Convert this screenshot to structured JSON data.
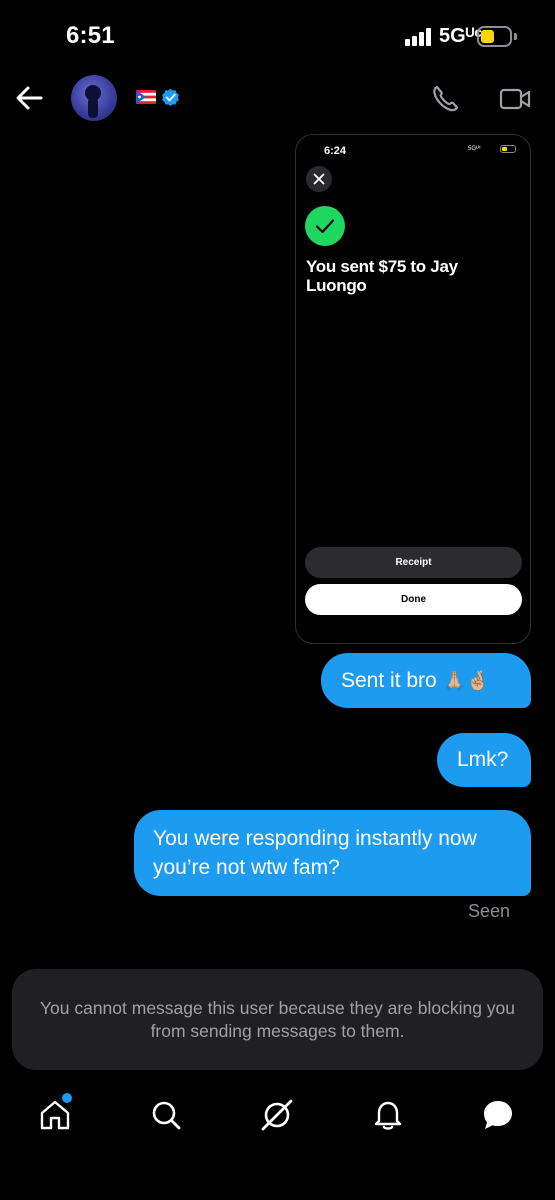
{
  "status_bar": {
    "time": "6:51",
    "network": "5Gᵁᶜ",
    "battery_color": "#ffd60a"
  },
  "header": {
    "back_icon": "arrow-left-icon",
    "avatar": "avatar",
    "flag": "puerto-rico-flag",
    "verified_icon": "verified-badge-icon",
    "call_icon": "phone-icon",
    "video_icon": "video-camera-icon"
  },
  "attachment": {
    "status_time": "6:24",
    "status_network": "5Gᵁᶜ",
    "title": "You sent $75 to Jay Luongo",
    "receipt_label": "Receipt",
    "done_label": "Done",
    "check_color": "#1ed760"
  },
  "messages": [
    {
      "text": "Sent it bro",
      "emoji": "🙏🏼🤞🏼"
    },
    {
      "text": "Lmk?"
    },
    {
      "text": "You were responding instantly now you’re not wtw fam?"
    }
  ],
  "seen_label": "Seen",
  "blocked_notice": "You cannot message this user because they are blocking you from sending messages to them.",
  "bubble_color": "#1d9bf0",
  "nav": {
    "items": [
      "home-icon",
      "search-icon",
      "grok-icon",
      "notifications-icon",
      "messages-icon"
    ]
  }
}
